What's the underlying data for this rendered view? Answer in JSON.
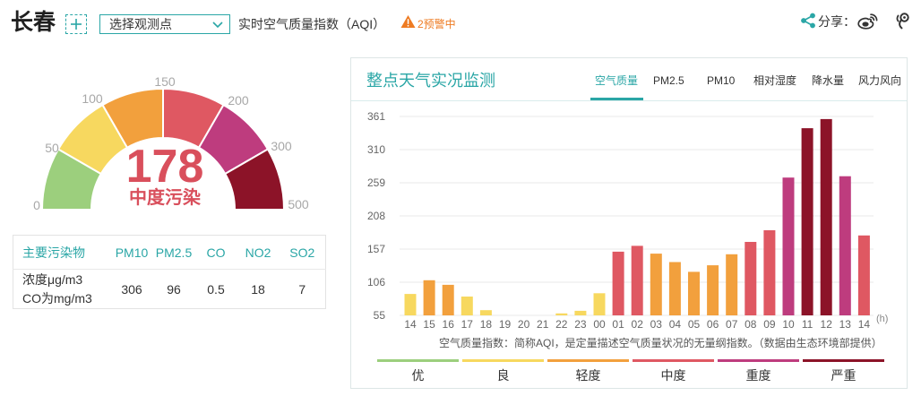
{
  "header": {
    "city": "长春",
    "station_select": "选择观测点",
    "aqi_title": "实时空气质量指数（AQI）",
    "warning_text": "2预警中",
    "share_label": "分享："
  },
  "icons": {
    "add": "plus-icon",
    "select": "chevron-down-icon",
    "warning": "warning-icon",
    "share": "share-icon",
    "weibo": "weibo-icon",
    "tencent": "tencent-weibo-icon"
  },
  "colors": {
    "accent": "#2aa6a6",
    "warning": "#ee7b22",
    "value": "#d94f5c"
  },
  "gauge": {
    "value": 178,
    "level": "中度污染",
    "scale_labels": [
      "0",
      "50",
      "100",
      "150",
      "200",
      "300",
      "500"
    ]
  },
  "levels": [
    {
      "label": "优",
      "color": "#9ccf7d"
    },
    {
      "label": "良",
      "color": "#f7d85f"
    },
    {
      "label": "轻度",
      "color": "#f2a03d"
    },
    {
      "label": "中度",
      "color": "#df5862"
    },
    {
      "label": "重度",
      "color": "#be3c7e"
    },
    {
      "label": "严重",
      "color": "#8c1328"
    }
  ],
  "pollutants": {
    "header_label": "主要污染物",
    "unit_line1": "浓度μg/m3",
    "unit_line2": "CO为mg/m3",
    "items": [
      {
        "name": "PM10",
        "value": "306"
      },
      {
        "name": "PM2.5",
        "value": "96"
      },
      {
        "name": "CO",
        "value": "0.5"
      },
      {
        "name": "NO2",
        "value": "18"
      },
      {
        "name": "SO2",
        "value": "7"
      }
    ]
  },
  "panel": {
    "title": "整点天气实况监测",
    "tabs": [
      {
        "label": "空气质量",
        "active": true
      },
      {
        "label": "PM2.5",
        "active": false
      },
      {
        "label": "PM10",
        "active": false
      },
      {
        "label": "相对湿度",
        "active": false
      },
      {
        "label": "降水量",
        "active": false
      },
      {
        "label": "风力风向",
        "active": false
      }
    ],
    "note": "空气质量指数：简称AQI，是定量描述空气质量状况的无量纲指数。（数据由生态环境部提供）"
  },
  "chart_data": {
    "type": "bar",
    "categories": [
      "14",
      "15",
      "16",
      "17",
      "18",
      "19",
      "20",
      "21",
      "22",
      "23",
      "00",
      "01",
      "02",
      "03",
      "04",
      "05",
      "06",
      "07",
      "08",
      "09",
      "10",
      "11",
      "12",
      "13",
      "14"
    ],
    "values": [
      88,
      109,
      102,
      84,
      63,
      null,
      null,
      null,
      58,
      62,
      89,
      153,
      162,
      150,
      137,
      122,
      132,
      149,
      168,
      186,
      267,
      343,
      357,
      269,
      178
    ],
    "yticks": [
      361,
      310,
      259,
      208,
      157,
      106,
      55
    ],
    "ylim": [
      55,
      361
    ],
    "xlabel": "(h)",
    "ylabel": "",
    "grid": true,
    "legend": "bottom"
  }
}
